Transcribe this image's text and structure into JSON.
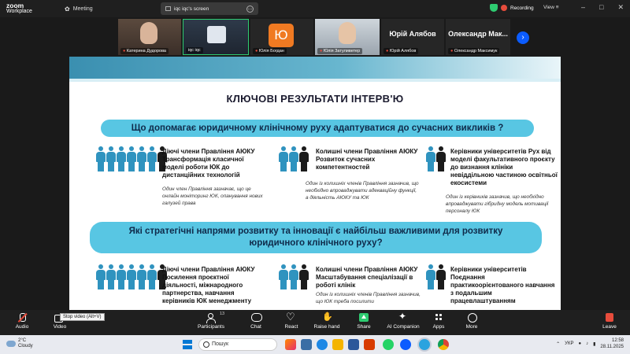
{
  "app": {
    "brand_top": "zoom",
    "brand_bottom": "Workplace",
    "meeting_label": "Meeting",
    "share_tab_label": "iqc iqc's screen",
    "recording_label": "Recording",
    "view_label": "View"
  },
  "participants": [
    {
      "name": "Катерина Дудорова"
    },
    {
      "name": "iqc iqc"
    },
    {
      "name": "Юлія Богдан",
      "initial": "Ю"
    },
    {
      "name": "Юлія Затуливетер"
    },
    {
      "name": "Юрій Алябов",
      "big": "Юрій Алябов"
    },
    {
      "name": "Олександр Максимук",
      "big": "Олександр Мак..."
    }
  ],
  "slide": {
    "title": "КЛЮЧОВІ РЕЗУЛЬТАТИ ІНТЕРВ'Ю",
    "q1": "Що допомагає юридичному клінічному руху адаптуватися до сучасних викликів ?",
    "q2_line1": "Які стратегічні напрями розвитку та інновації є найбільш важливими для розвитку",
    "q2_line2": "юридичного клінічного руху?",
    "groups_top": [
      {
        "title": "Діючі члени Правління АЮКУ Трансформація класичної моделі роботи ЮК до дистанційних технологій",
        "note": "Один член Правління зазначає, що це онлайн моніторинг ЮК, опанування нових галузей права"
      },
      {
        "title": "Колишні члени Правління АЮКУ Розвиток сучасних компетентностей",
        "note": "Один із колишніх членів Правління зазначив, що необхідно впроваджувати адекваційну функції, а діяльність АЮКУ та ЮК"
      },
      {
        "title": "Керівники університетів Рух від моделі факультативного проєкту до визнання клініки невіддільною частиною освітньої екосистеми",
        "note": "Один із керівників зазначив, що необхідно впроваджувати гібридну модель мотивації персоналу ЮК"
      }
    ],
    "groups_bottom": [
      {
        "title": "Діючі члени Правління АЮКУ Посилення проєктної діяльності, міжнародного партнерства, навчання керівників ЮК менеджменту"
      },
      {
        "title": "Колишні члени Правління АЮКУ Масштабування спеціалізації в роботі клінік",
        "note": "Один із колишніх членів Правління зазначив, що ЮК треба посилити"
      },
      {
        "title": "Керівники університетів Поєднання практикоорієнтованого навчання з подальшим працевлаштуванням"
      }
    ]
  },
  "toolbar": {
    "audio": "Audio",
    "video": "Video",
    "video_tooltip": "Stop video (Alt+V)",
    "participants": "Participants",
    "participants_count": "13",
    "chat": "Chat",
    "react": "React",
    "raise_hand": "Raise hand",
    "share": "Share",
    "ai_companion": "AI Companion",
    "apps": "Apps",
    "more": "More",
    "leave": "Leave"
  },
  "taskbar": {
    "temp": "2°C",
    "weather": "Cloudy",
    "search_placeholder": "Пошук",
    "lang": "УКР",
    "time": "12:58",
    "date": "28.11.2025"
  }
}
